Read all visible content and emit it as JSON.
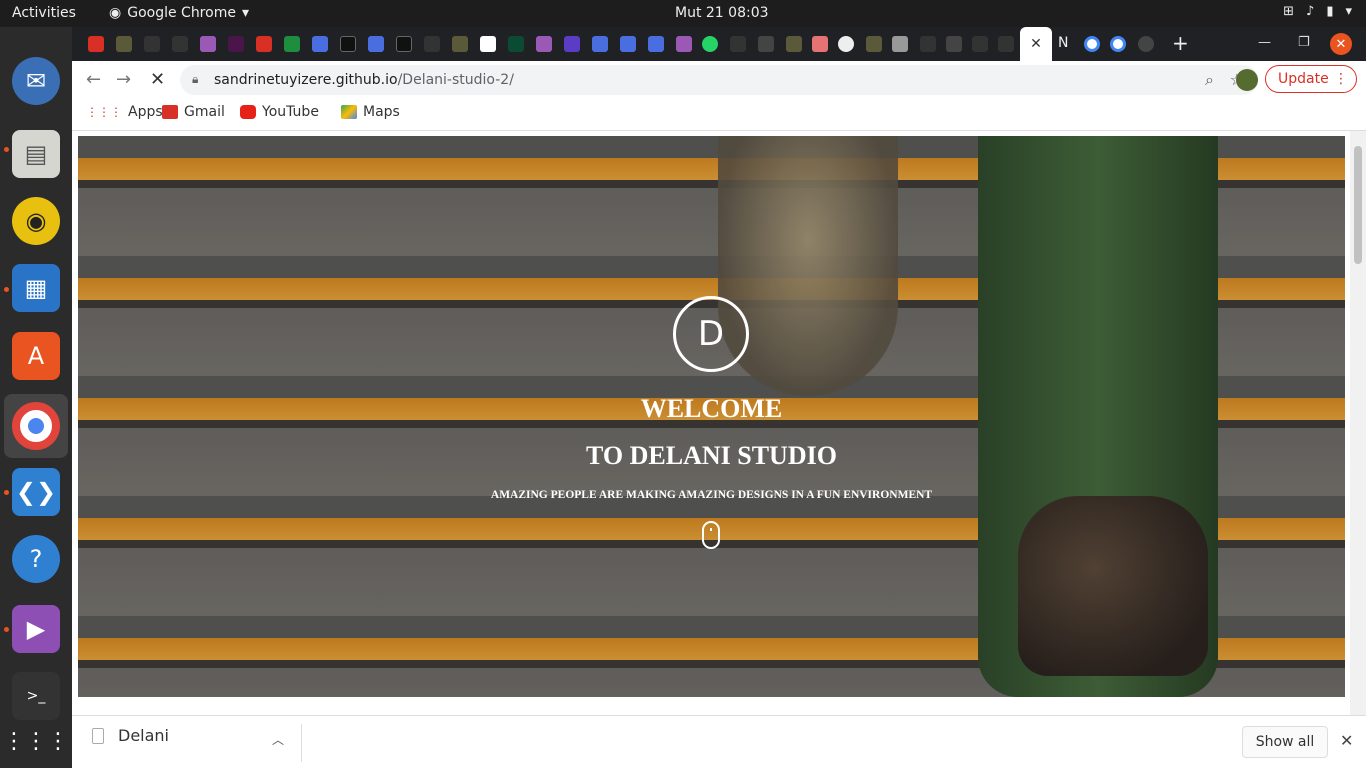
{
  "topbar": {
    "activities": "Activities",
    "app_name": "Google Chrome",
    "clock": "Mut 21  08:03"
  },
  "browser": {
    "new_tab_symbol": "+",
    "active_tab_letter": "N",
    "url_host": "sandrinetuyizere.github.io",
    "url_path": "/Delani-studio-2/",
    "update_label": "Update"
  },
  "bookmarks": {
    "apps": "Apps",
    "gmail": "Gmail",
    "youtube": "YouTube",
    "maps": "Maps"
  },
  "hero": {
    "logo_letter": "D",
    "title_line1": "WELCOME",
    "title_line2": "TO DELANI STUDIO",
    "subtitle": "AMAZING PEOPLE ARE MAKING AMAZING DESIGNS IN A FUN ENVIRONMENT"
  },
  "downloads": {
    "file_name": "Delani",
    "show_all": "Show all"
  },
  "colors": {
    "ubuntu_orange": "#e95420",
    "update_red": "#d93025",
    "stair_orange": "#e7a33a"
  }
}
